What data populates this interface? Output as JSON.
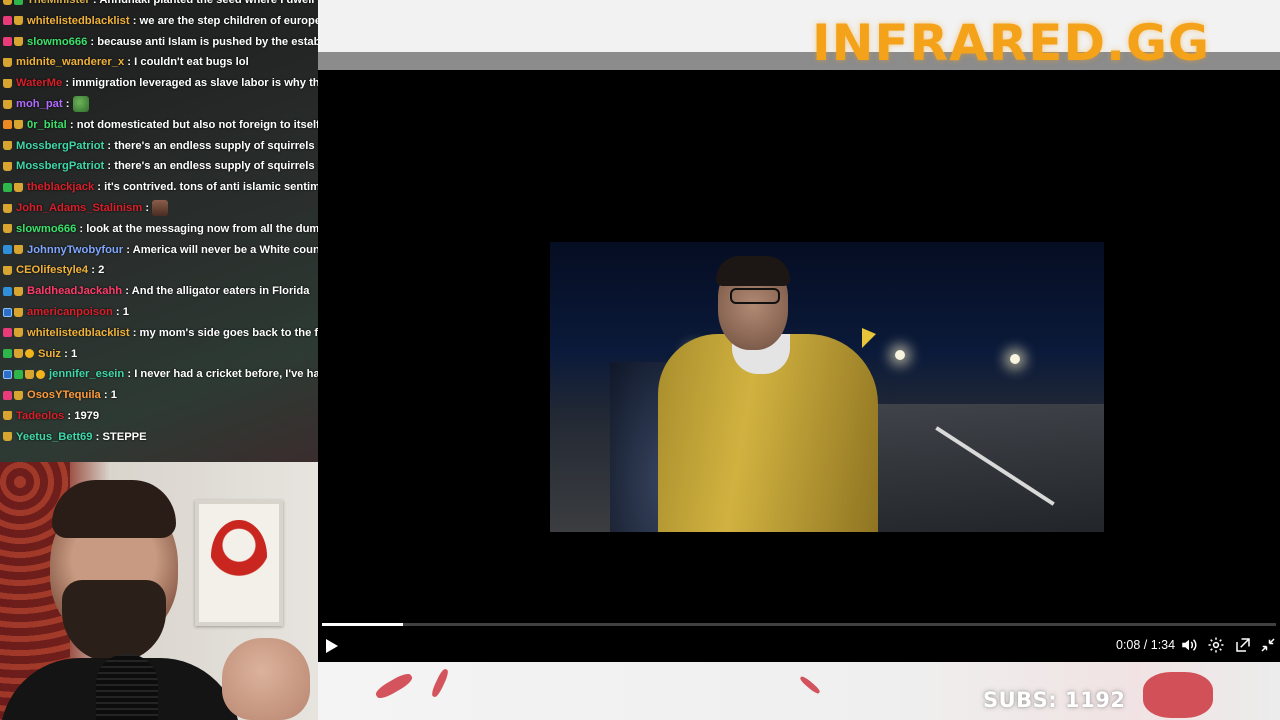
{
  "brand": {
    "text": "INFRARED.GG",
    "color": "#f4a21a"
  },
  "chat": {
    "lines": [
      {
        "badges": [
          "crown",
          "green"
        ],
        "user": "TheMinister",
        "user_color": "#d8b04a",
        "message": "Annunaki planted the seed where I dwell"
      },
      {
        "badges": [
          "pink",
          "crown"
        ],
        "user": "whitelistedblacklist",
        "user_color": "#f0b23a",
        "message": "we are the step children of europe"
      },
      {
        "badges": [
          "pink",
          "crown"
        ],
        "user": "slowmo666",
        "user_color": "#3be06a",
        "message": "because anti Islam is pushed by the establis"
      },
      {
        "badges": [
          "crown"
        ],
        "user": "midnite_wanderer_x",
        "user_color": "#f0b23a",
        "message": "I couldn't eat bugs lol"
      },
      {
        "badges": [
          "crown"
        ],
        "user": "WaterMe",
        "user_color": "#d81f2a",
        "message": "immigration leveraged as slave labor is why there'"
      },
      {
        "badges": [
          "crown"
        ],
        "user": "moh_pat",
        "user_color": "#b16cff",
        "message": "",
        "emote": "pepe"
      },
      {
        "badges": [
          "orange",
          "crown"
        ],
        "user": "0r_bital",
        "user_color": "#3be06a",
        "message": "not domesticated but also not foreign to itself"
      },
      {
        "badges": [
          "crown"
        ],
        "user": "MossbergPatriot",
        "user_color": "#3fd6a8",
        "message": "there's an endless supply of squirrels and"
      },
      {
        "badges": [
          "crown"
        ],
        "user": "MossbergPatriot",
        "user_color": "#3fd6a8",
        "message": "there's an endless supply of squirrels and"
      },
      {
        "badges": [
          "green",
          "crown"
        ],
        "user": "theblackjack",
        "user_color": "#d81f2a",
        "message": "it's contrived. tons of anti islamic sentimer"
      },
      {
        "badges": [
          "crown"
        ],
        "user": "John_Adams_Stalinism",
        "user_color": "#d81f2a",
        "message": "",
        "emote": "face"
      },
      {
        "badges": [
          "crown"
        ],
        "user": "slowmo666",
        "user_color": "#3be06a",
        "message": "look at the messaging now from all the duml"
      },
      {
        "badges": [
          "blue",
          "crown"
        ],
        "user": "JohnnyTwobyfour",
        "user_color": "#7fa7ff",
        "message": "America will never be a White country"
      },
      {
        "badges": [
          "crown"
        ],
        "user": "CEOlifestyle4",
        "user_color": "#f0b23a",
        "message": "2"
      },
      {
        "badges": [
          "blue",
          "crown"
        ],
        "user": "BaldheadJackahh",
        "user_color": "#ff3b6a",
        "message": "And the alligator eaters in Florida"
      },
      {
        "badges": [
          "blueframe",
          "crown"
        ],
        "user": "americanpoison",
        "user_color": "#d81f2a",
        "message": "1"
      },
      {
        "badges": [
          "pink",
          "crown"
        ],
        "user": "whitelistedblacklist",
        "user_color": "#f0b23a",
        "message": "my mom's side goes back to the foui"
      },
      {
        "badges": [
          "green",
          "crown",
          "gold"
        ],
        "user": "Suiz",
        "user_color": "#f0b23a",
        "message": "1"
      },
      {
        "badges": [
          "blueframe",
          "green",
          "crown",
          "gold"
        ],
        "user": "jennifer_esein",
        "user_color": "#3fd6a8",
        "message": "I never had a cricket before, I've had s"
      },
      {
        "badges": [
          "pink",
          "crown"
        ],
        "user": "OsosYTequila",
        "user_color": "#ff9a3a",
        "message": "1"
      },
      {
        "badges": [
          "crown"
        ],
        "user": "Tadeolos",
        "user_color": "#d81f2a",
        "message": "1979"
      },
      {
        "badges": [
          "crown"
        ],
        "user": "Yeetus_Bett69",
        "user_color": "#3fd6a8",
        "message": "STEPPE"
      }
    ]
  },
  "player": {
    "current_time": "0:08",
    "duration": "1:34",
    "time_display": "0:08 / 1:34",
    "progress": 0.085,
    "icons": {
      "play": "play-icon",
      "volume": "volume-icon",
      "settings": "gear-icon",
      "popout": "popout-icon",
      "fullscreen": "exit-fullscreen-icon"
    }
  },
  "subs": {
    "label": "SUBS:",
    "count": "1192",
    "text": "SUBS: 1192"
  }
}
